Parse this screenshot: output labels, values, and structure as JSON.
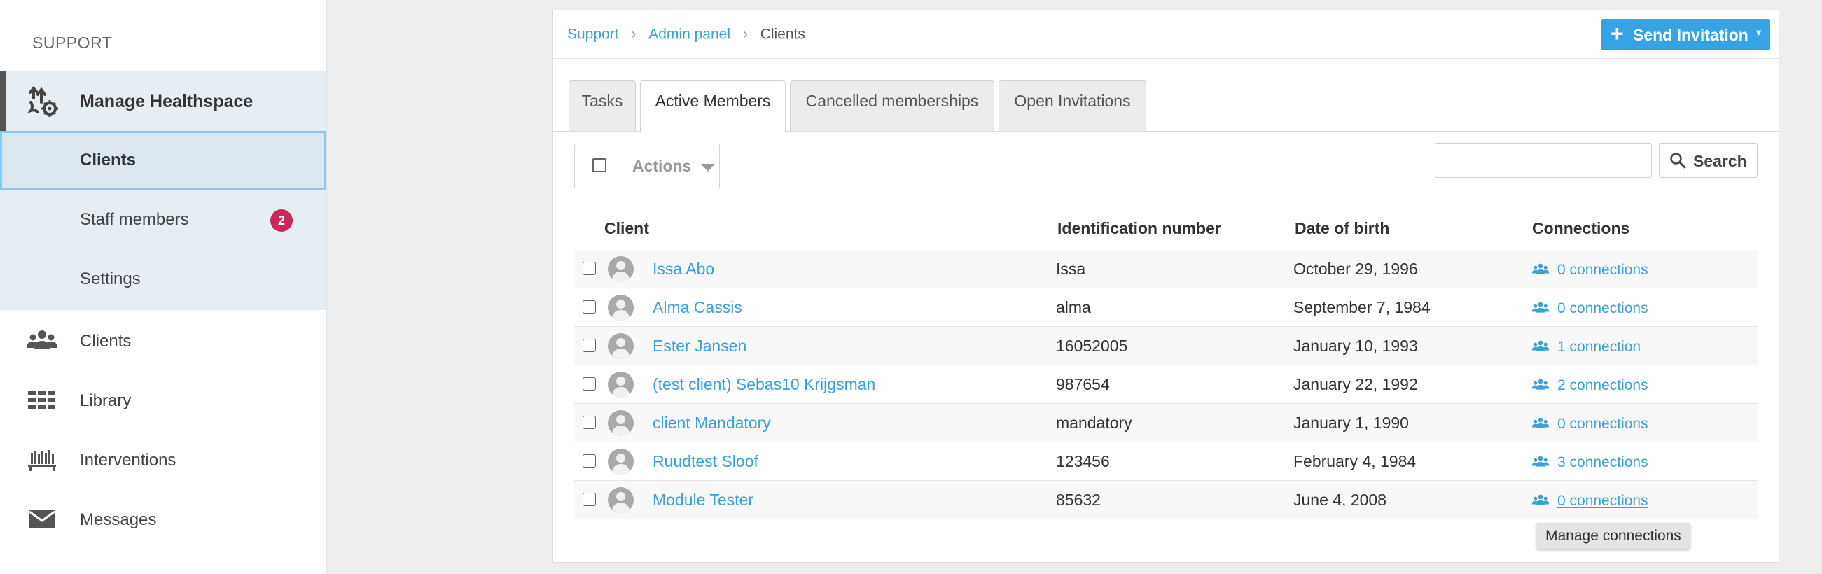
{
  "sidebar": {
    "org_name": "SUPPORT",
    "manage": {
      "label": "Manage Healthspace"
    },
    "subnav": [
      {
        "label": "Clients",
        "active": true
      },
      {
        "label": "Staff members",
        "badge": "2"
      },
      {
        "label": "Settings"
      }
    ],
    "nav": [
      {
        "label": "Clients",
        "icon": "users-icon"
      },
      {
        "label": "Library",
        "icon": "grid-icon"
      },
      {
        "label": "Interventions",
        "icon": "bookshelf-icon"
      },
      {
        "label": "Messages",
        "icon": "envelope-icon"
      }
    ]
  },
  "breadcrumb": {
    "items": [
      "Support",
      "Admin panel"
    ],
    "current": "Clients"
  },
  "send_invitation": {
    "label": "Send Invitation"
  },
  "tabs": [
    {
      "label": "Tasks"
    },
    {
      "label": "Active Members",
      "active": true
    },
    {
      "label": "Cancelled memberships"
    },
    {
      "label": "Open Invitations"
    }
  ],
  "toolbar": {
    "actions_label": "Actions",
    "search_placeholder": "",
    "search_label": "Search"
  },
  "table": {
    "headers": {
      "client": "Client",
      "id": "Identification number",
      "dob": "Date of birth",
      "connections": "Connections"
    },
    "rows": [
      {
        "name": "Issa Abo",
        "id": "Issa",
        "dob": "October 29, 1996",
        "connections": "0 connections"
      },
      {
        "name": "Alma Cassis",
        "id": "alma",
        "dob": "September 7, 1984",
        "connections": "0 connections"
      },
      {
        "name": "Ester Jansen",
        "id": "16052005",
        "dob": "January 10, 1993",
        "connections": "1 connection"
      },
      {
        "name": "(test client) Sebas10 Krijgsman",
        "id": "987654",
        "dob": "January 22, 1992",
        "connections": "2 connections"
      },
      {
        "name": "client Mandatory",
        "id": "mandatory",
        "dob": "January 1, 1990",
        "connections": "0 connections"
      },
      {
        "name": "Ruudtest Sloof",
        "id": "123456",
        "dob": "February 4, 1984",
        "connections": "3 connections"
      },
      {
        "name": "Module Tester",
        "id": "85632",
        "dob": "June 4, 2008",
        "connections": "0 connections",
        "hovered": true
      }
    ]
  },
  "tooltip": {
    "text": "Manage connections"
  },
  "colors": {
    "accent": "#37a3e5",
    "link": "#3aa0d6",
    "badge": "#c8285a"
  }
}
